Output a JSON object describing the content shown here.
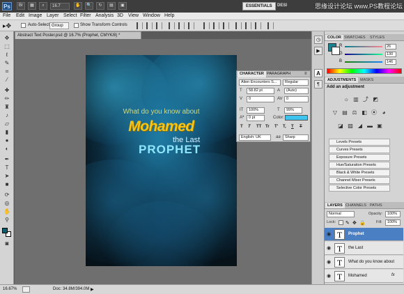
{
  "appbar": {
    "logo": "Ps",
    "zoom": "16.7",
    "workspaces": [
      "ESSENTIALS",
      "DESI"
    ],
    "watermark": "思缘设计论坛 www.PS教程论坛"
  },
  "menu": [
    "File",
    "Edit",
    "Image",
    "Layer",
    "Select",
    "Filter",
    "Analysis",
    "3D",
    "View",
    "Window",
    "Help"
  ],
  "options": {
    "auto_select_label": "Auto-Select:",
    "auto_select_value": "Group",
    "transform_label": "Show Transform Controls"
  },
  "document": {
    "tab_title": "Abstract Text Poster.psd @ 16.7% (Prophet, CMYK/8) *",
    "line1": "What do you know about",
    "line2": "Mohamed",
    "line3": "the Last",
    "line4": "PROPHET"
  },
  "status": {
    "zoom": "16.67%",
    "doc": "Doc: 34.8M/394.0M"
  },
  "character": {
    "tabs": [
      "CHARACTER",
      "PARAGRAPH"
    ],
    "font_family": "Alien Encounters S...",
    "font_style": "Regular",
    "size": "58.82 pt",
    "leading": "(Auto)",
    "kerning": "0",
    "tracking": "0",
    "vscale": "100%",
    "hscale": "99%",
    "baseline": "0 pt",
    "color_label": "Color:",
    "language": "English: UK",
    "aa_prefix": "aa",
    "antialias": "Sharp",
    "glyphs": [
      "T",
      "T",
      "TT",
      "Tr",
      "T'",
      "T,",
      "T",
      "T"
    ]
  },
  "color_panel": {
    "tabs": [
      "COLOR",
      "SWATCHES",
      "STYLES"
    ],
    "labels": [
      "R",
      "G",
      "B"
    ],
    "values": [
      "26",
      "130",
      "146"
    ],
    "current_color": "#1a8292"
  },
  "adjustments": {
    "tabs": [
      "ADJUSTMENTS",
      "MASKS"
    ],
    "heading": "Add an adjustment",
    "presets": [
      "Levels Presets",
      "Curves Presets",
      "Exposure Presets",
      "Hue/Saturation Presets",
      "Black & White Presets",
      "Channel Mixer Presets",
      "Selective Color Presets"
    ]
  },
  "layers": {
    "tabs": [
      "LAYERS",
      "CHANNELS",
      "PATHS"
    ],
    "blend_mode": "Normal",
    "opacity_label": "Opacity:",
    "opacity": "100%",
    "lock_label": "Lock:",
    "fill_label": "Fill:",
    "fill": "100%",
    "items": [
      {
        "name": "Prophet",
        "selected": true
      },
      {
        "name": "the Last",
        "selected": false
      },
      {
        "name": "What do you know about",
        "selected": false
      },
      {
        "name": "Mohamed",
        "selected": false
      }
    ],
    "fx_label": "fx"
  }
}
